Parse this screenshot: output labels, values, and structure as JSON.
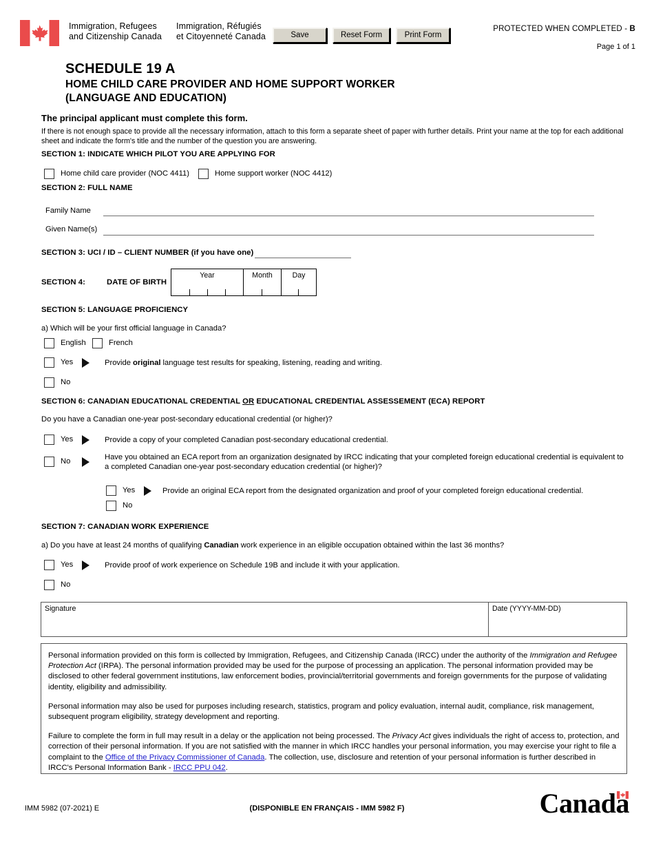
{
  "header": {
    "flag_icon": "canada-flag-icon",
    "wordmark_en_line1": "Immigration, Refugees",
    "wordmark_en_line2": "and Citizenship Canada",
    "wordmark_fr_line1": "Immigration, Réfugiés",
    "wordmark_fr_line2": "et Citoyenneté Canada",
    "buttons": {
      "save": "Save",
      "reset": "Reset Form",
      "print": "Print Form"
    },
    "protected_prefix": "PROTECTED WHEN COMPLETED - ",
    "protected_level": "B",
    "page_number": "Page 1 of 1"
  },
  "title": {
    "line1": "SCHEDULE 19 A",
    "line2": "HOME CHILD CARE PROVIDER AND HOME SUPPORT WORKER",
    "line3": "(LANGUAGE AND EDUCATION)"
  },
  "lead": "The principal applicant must complete this form.",
  "intro": "If there is not enough space to provide all the necessary information, attach to this form a separate sheet of paper with further details. Print your name at the top for each additional sheet and indicate the form's title and the number of the question you are answering.",
  "section1": {
    "heading": "SECTION 1: INDICATE WHICH PILOT YOU ARE APPLYING FOR",
    "option1": "Home child care provider (NOC 4411)",
    "option2": "Home support worker (NOC 4412)"
  },
  "section2": {
    "heading": "SECTION 2: FULL NAME",
    "family_name_label": "Family Name",
    "family_name_value": "",
    "given_names_label": "Given Name(s)",
    "given_names_value": ""
  },
  "section3": {
    "heading": "SECTION 3: UCI / ID – CLIENT NUMBER (if you have one)",
    "value": ""
  },
  "section4": {
    "label": "SECTION 4:",
    "heading": "DATE  OF BIRTH",
    "year_label": "Year",
    "month_label": "Month",
    "day_label": "Day",
    "year_value": "",
    "month_value": "",
    "day_value": ""
  },
  "section5": {
    "heading": "SECTION 5: LANGUAGE PROFICIENCY",
    "question_a": "a) Which will be your first official language in Canada?",
    "english": "English",
    "french": "French",
    "yes": "Yes",
    "no": "No",
    "yes_note_pre": "Provide ",
    "yes_note_bold": "original",
    "yes_note_post": " language test results for speaking, listening, reading and writing."
  },
  "section6": {
    "heading_pre": "SECTION 6: CANADIAN EDUCATIONAL CREDENTIAL ",
    "heading_or": "OR",
    "heading_post": " EDUCATIONAL CREDENTIAL ASSESSEMENT (ECA) REPORT",
    "question": "Do you have a Canadian one-year post-secondary educational credential (or higher)?",
    "yes": "Yes",
    "no": "No",
    "yes_note": "Provide a copy of your completed Canadian post-secondary educational credential.",
    "no_note": "Have you obtained an ECA report from an organization designated by IRCC indicating that your completed foreign educational credential is equivalent to a completed Canadian one-year post-secondary education credential (or higher)?",
    "sub_yes": "Yes",
    "sub_no": "No",
    "sub_yes_note": "Provide an original ECA report from the designated organization and proof of your completed foreign educational credential."
  },
  "section7": {
    "heading": "SECTION 7: CANADIAN WORK EXPERIENCE",
    "question_a_pre": "a) Do you have at least 24 months of qualifying ",
    "question_a_bold": "Canadian",
    "question_a_post": " work experience in an eligible occupation obtained within the last 36 months?",
    "yes": "Yes",
    "no": "No",
    "yes_note": "Provide proof of work experience on Schedule 19B and include it with your application."
  },
  "signature": {
    "signature_label": "Signature",
    "signature_value": "",
    "date_label": "Date (YYYY-MM-DD)",
    "date_value": ""
  },
  "privacy": {
    "p1_a": "Personal information provided on this form is collected by Immigration, Refugees, and Citizenship Canada (IRCC) under the authority of the ",
    "p1_i": "Immigration and Refugee Protection Act",
    "p1_b": " (IRPA). The personal information provided may be used for the purpose of processing an application. The personal information provided may be disclosed to other federal government institutions, law enforcement bodies, provincial/territorial governments and foreign governments for the purpose of validating identity, eligibility and admissibility.",
    "p2": "Personal information may also be used for purposes including research, statistics, program and policy evaluation, internal audit, compliance, risk management, subsequent program eligibility, strategy development and reporting.",
    "p3_a": "Failure to complete the form in full may result in a delay or the application not being processed. The ",
    "p3_i": "Privacy Act",
    "p3_b": " gives individuals the right of access to, protection, and correction of their personal information. If you are not satisfied with the manner in which IRCC handles your personal information, you may exercise your right to file a complaint to the ",
    "p3_link1": "Office of the Privacy Commissioner of Canada",
    "p3_c": ". The collection, use, disclosure and retention of your personal information is further described in IRCC's Personal Information Bank - ",
    "p3_link2": "IRCC PPU 042",
    "p3_d": "."
  },
  "footer": {
    "form_code": "IMM 5982 (07-2021) E",
    "french_note": "(DISPONIBLE EN FRANÇAIS - IMM 5982 F)",
    "wordmark": "Canada"
  },
  "colors": {
    "link": "#2020cc",
    "flag_red": "#ea4b4b",
    "button_face": "#d8d5cb"
  }
}
